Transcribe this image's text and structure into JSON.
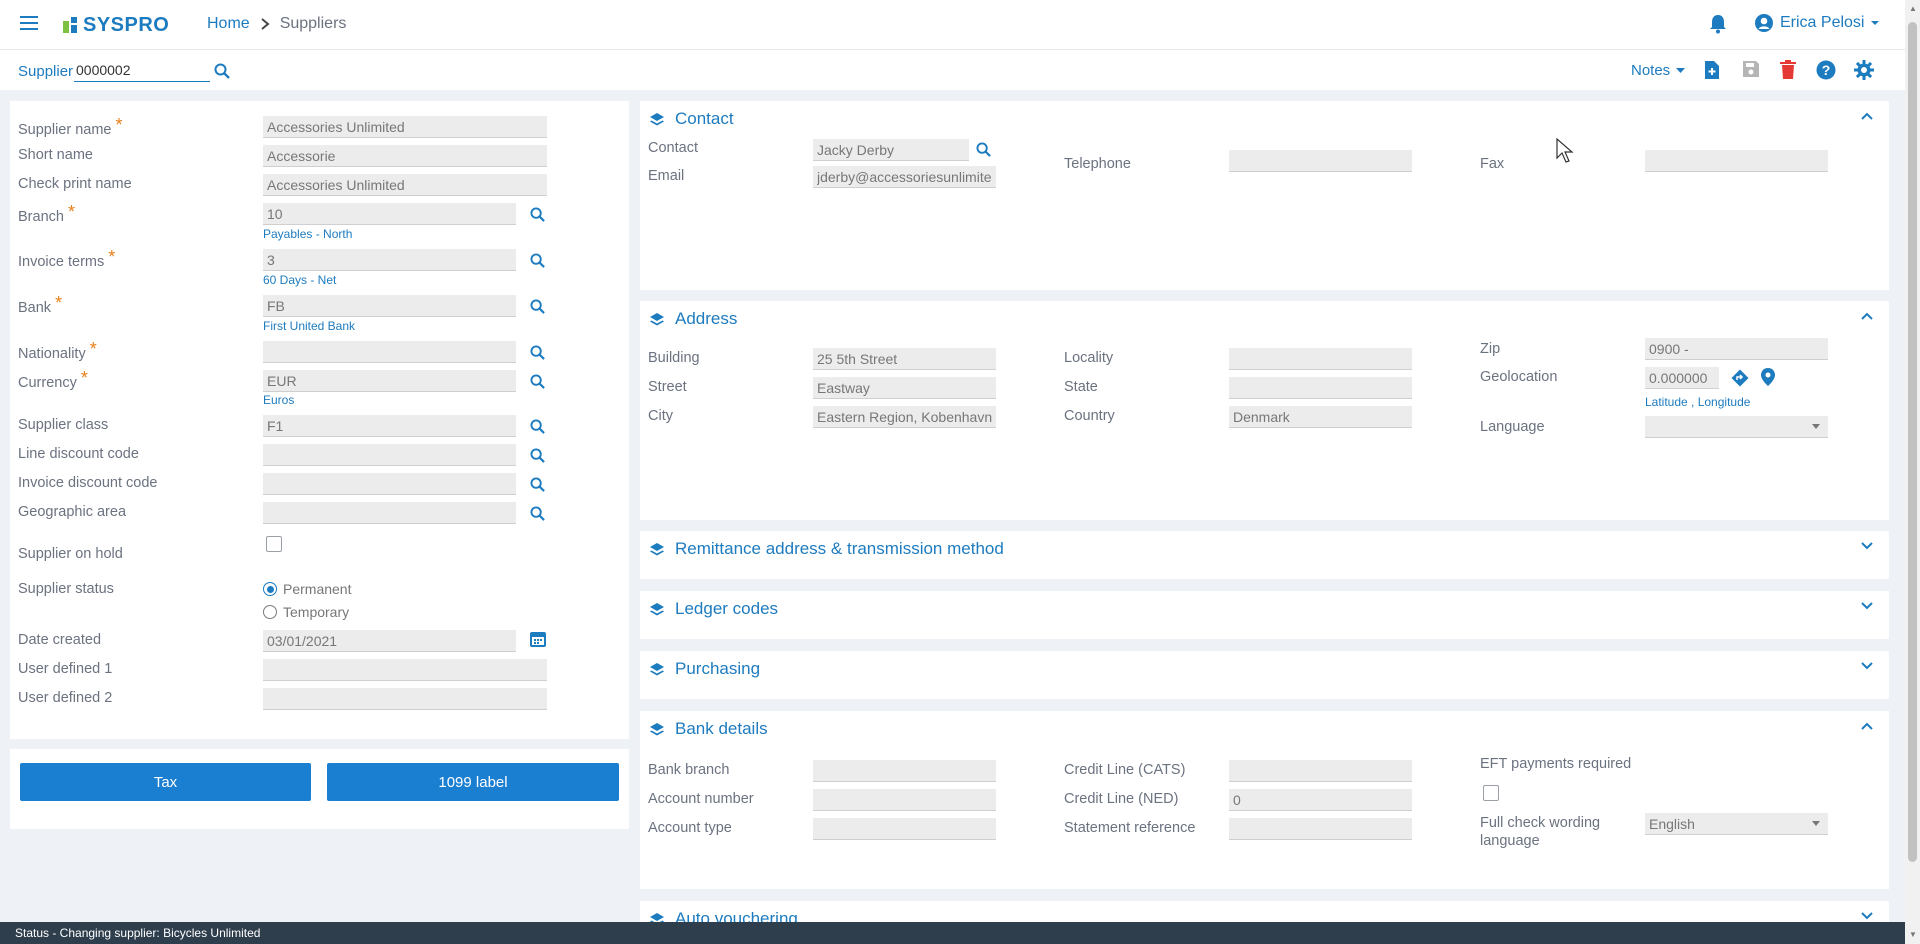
{
  "app": {
    "brand": "SYSPRO",
    "accent": "#1d7bbf",
    "danger": "#e53935"
  },
  "breadcrumb": {
    "home": "Home",
    "current": "Suppliers"
  },
  "user": {
    "name": "Erica Pelosi"
  },
  "toolbar": {
    "supplier_label": "Supplier",
    "supplier_value": "0000002",
    "notes_label": "Notes"
  },
  "left": {
    "supplier_name": {
      "label": "Supplier name",
      "value": "Accessories Unlimited"
    },
    "short_name": {
      "label": "Short name",
      "value": "Accessorie"
    },
    "check_print_name": {
      "label": "Check print name",
      "value": "Accessories Unlimited"
    },
    "branch": {
      "label": "Branch",
      "value": "10",
      "hint": "Payables - North"
    },
    "invoice_terms": {
      "label": "Invoice terms",
      "value": "3",
      "hint": "60 Days - Net"
    },
    "bank": {
      "label": "Bank",
      "value": "FB",
      "hint": "First United Bank"
    },
    "nationality": {
      "label": "Nationality",
      "value": ""
    },
    "currency": {
      "label": "Currency",
      "value": "EUR",
      "hint": "Euros"
    },
    "supplier_class": {
      "label": "Supplier class",
      "value": "F1"
    },
    "line_discount": {
      "label": "Line discount code",
      "value": ""
    },
    "invoice_discount": {
      "label": "Invoice discount code",
      "value": ""
    },
    "geographic_area": {
      "label": "Geographic area",
      "value": ""
    },
    "on_hold": {
      "label": "Supplier on hold"
    },
    "status": {
      "label": "Supplier status",
      "opt1": "Permanent",
      "opt2": "Temporary",
      "selected": "Permanent"
    },
    "date_created": {
      "label": "Date created",
      "value": "03/01/2021"
    },
    "user1": {
      "label": "User defined 1",
      "value": ""
    },
    "user2": {
      "label": "User defined 2",
      "value": ""
    },
    "required_mark": "*"
  },
  "buttons": {
    "tax": "Tax",
    "label1099": "1099 label"
  },
  "contact": {
    "title": "Contact",
    "contact_label": "Contact",
    "contact_value": "Jacky Derby",
    "email_label": "Email",
    "email_value": "jderby@accessoriesunlimited",
    "telephone_label": "Telephone",
    "telephone_value": "",
    "fax_label": "Fax",
    "fax_value": ""
  },
  "address": {
    "title": "Address",
    "building_label": "Building",
    "building_value": "25 5th Street",
    "street_label": "Street",
    "street_value": "Eastway",
    "city_label": "City",
    "city_value": "Eastern Region, Kobenhavn",
    "locality_label": "Locality",
    "locality_value": "",
    "state_label": "State",
    "state_value": "",
    "country_label": "Country",
    "country_value": "Denmark",
    "zip_label": "Zip",
    "zip_value": "0900 -",
    "geo_label": "Geolocation",
    "geo_value": "0.000000",
    "geo_hint": "Latitude , Longitude",
    "language_label": "Language",
    "language_value": ""
  },
  "sections": {
    "remittance": "Remittance address & transmission method",
    "ledger": "Ledger codes",
    "purchasing": "Purchasing",
    "auto_vouchering": "Auto vouchering"
  },
  "bank_details": {
    "title": "Bank details",
    "branch_label": "Bank branch",
    "branch_value": "",
    "account_number_label": "Account number",
    "account_number_value": "",
    "account_type_label": "Account type",
    "account_type_value": "",
    "cats_label": "Credit Line (CATS)",
    "cats_value": "",
    "ned_label": "Credit Line (NED)",
    "ned_value": "0",
    "statement_label": "Statement reference",
    "statement_value": "",
    "eft_label": "EFT payments required",
    "wording_label_1": "Full check wording",
    "wording_label_2": "language",
    "wording_value": "English"
  },
  "status_bar": "Status - Changing supplier: Bicycles Unlimited"
}
